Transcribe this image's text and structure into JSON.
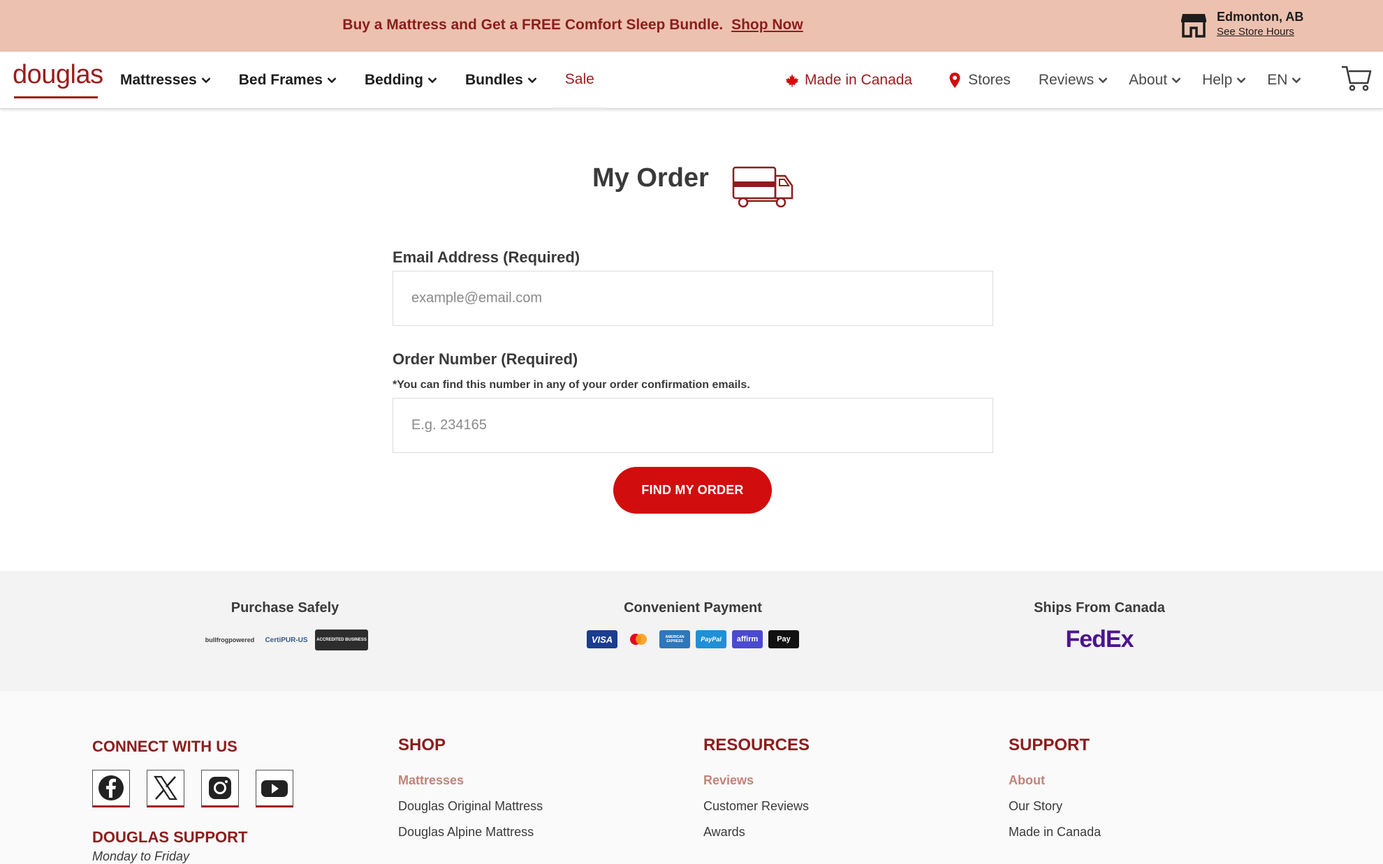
{
  "colors": {
    "brand": "#9b1c1c",
    "cta": "#d20d0d",
    "promo_bg": "#edc1af"
  },
  "promo": {
    "text": "Buy a Mattress and Get a FREE Comfort Sleep Bundle.",
    "link": "Shop Now",
    "store_city": "Edmonton, AB",
    "store_hours": "See Store Hours"
  },
  "header": {
    "logo": "douglas",
    "nav": [
      "Mattresses",
      "Bed Frames",
      "Bedding",
      "Bundles"
    ],
    "sale": "Sale",
    "made_in_canada": "Made in Canada",
    "stores": "Stores",
    "reviews": "Reviews",
    "about": "About",
    "help": "Help",
    "language": "EN",
    "icons": [
      "maple-leaf-icon",
      "map-pin-icon",
      "cart-icon",
      "chevron-down-icon",
      "store-icon"
    ]
  },
  "main": {
    "title": "My Order",
    "email_label": "Email Address (Required)",
    "email_placeholder": "example@email.com",
    "order_label": "Order Number (Required)",
    "order_hint": "*You can find this number in any of your order confirmation emails.",
    "order_placeholder": "E.g. 234165",
    "submit": "FIND MY ORDER"
  },
  "trust": {
    "purchase_title": "Purchase Safely",
    "purchase_badges": [
      "bullfrogpowered",
      "CertiPUR-US",
      "ACCREDITED BUSINESS"
    ],
    "payment_title": "Convenient Payment",
    "payment_methods": [
      "VISA",
      "Mastercard",
      "AMERICAN EXPRESS",
      "PayPal",
      "affirm",
      "Pay"
    ],
    "ships_title": "Ships From Canada",
    "ships_logo": "FedEx"
  },
  "footer": {
    "connect": "CONNECT WITH US",
    "social_icons": [
      "facebook-icon",
      "x-icon",
      "instagram-icon",
      "youtube-icon"
    ],
    "support_title": "DOUGLAS SUPPORT",
    "support_hours": "Monday to Friday",
    "shop": {
      "title": "SHOP",
      "sub": "Mattresses",
      "links": [
        "Douglas Original Mattress",
        "Douglas Alpine Mattress"
      ]
    },
    "resources": {
      "title": "RESOURCES",
      "sub": "Reviews",
      "links": [
        "Customer Reviews",
        "Awards"
      ]
    },
    "support": {
      "title": "SUPPORT",
      "sub": "About",
      "links": [
        "Our Story",
        "Made in Canada"
      ]
    }
  }
}
